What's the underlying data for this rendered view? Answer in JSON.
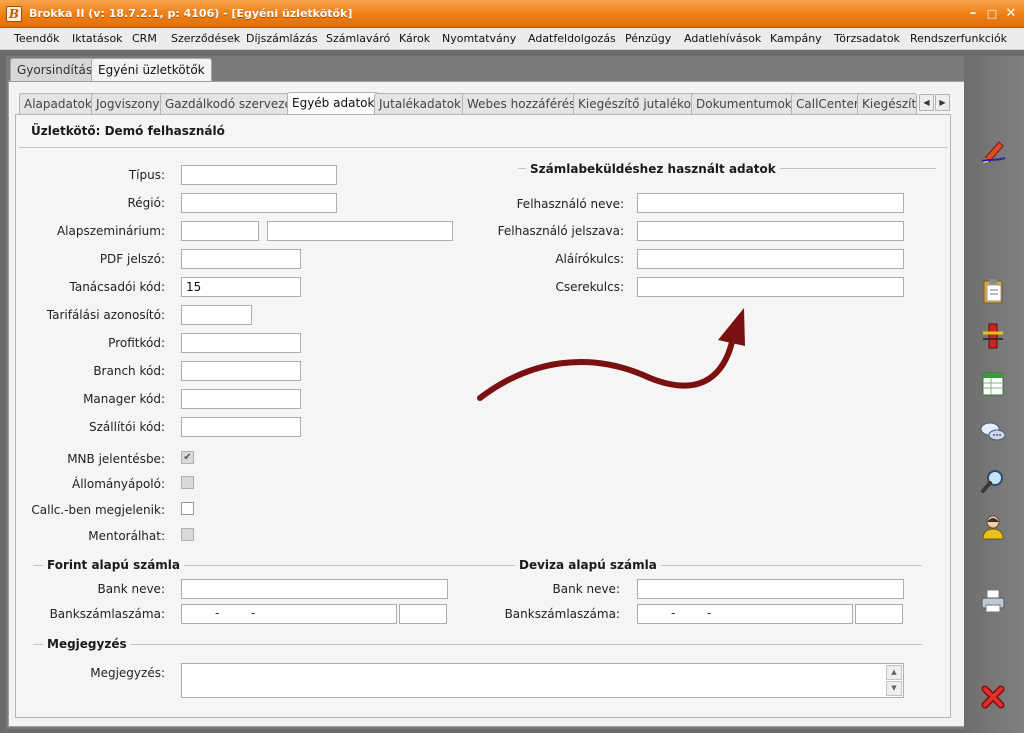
{
  "window": {
    "title": "Brokka II (v: 18.7.2.1, p: 4106) - [Egyéni üzletkötők]",
    "app_icon_letter": "B"
  },
  "menu": [
    "Teendők",
    "Iktatások",
    "CRM",
    "Szerződések",
    "Díjszámlázás",
    "Számlaváró",
    "Károk",
    "Nyomtatvány",
    "Adatfeldolgozás",
    "Pénzügy",
    "Adatlehívások",
    "Kampány",
    "Törzsadatok",
    "Rendszerfunkciók"
  ],
  "top_tabs": [
    "Gyorsindítás",
    "Egyéni üzletkötők"
  ],
  "sub_tabs": [
    "Alapadatok",
    "Jogviszony",
    "Gazdálkodó szervezet",
    "Egyéb adatok",
    "Jutalékadatok",
    "Webes hozzáférés",
    "Kiegészítő jutalékok",
    "Dokumentumok",
    "CallCenter",
    "Kiegészítő"
  ],
  "header": {
    "agent": "Üzletkötő: Demó felhasználó"
  },
  "left_fields": {
    "tipus": {
      "label": "Típus:",
      "value": ""
    },
    "regio": {
      "label": "Régió:",
      "value": ""
    },
    "alapszeminarium": {
      "label": "Alapszeminárium:",
      "value1": "",
      "value2": ""
    },
    "pdf_jelszo": {
      "label": "PDF jelszó:",
      "value": ""
    },
    "tanacsadoi_kod": {
      "label": "Tanácsadói kód:",
      "value": "15"
    },
    "tarifalasi": {
      "label": "Tarifálási azonosító:",
      "value": ""
    },
    "profitkod": {
      "label": "Profitkód:",
      "value": ""
    },
    "branch": {
      "label": "Branch kód:",
      "value": ""
    },
    "manager": {
      "label": "Manager kód:",
      "value": ""
    },
    "szallitoi": {
      "label": "Szállítói kód:",
      "value": ""
    }
  },
  "checkboxes": {
    "mnb": {
      "label": "MNB jelentésbe:",
      "checked": true,
      "disabled": true
    },
    "allomany": {
      "label": "Állományápoló:",
      "checked": false,
      "disabled": true
    },
    "callc": {
      "label": "Callc.-ben megjelenik:",
      "checked": false,
      "disabled": false
    },
    "mentor": {
      "label": "Mentorálhat:",
      "checked": false,
      "disabled": true
    }
  },
  "invoice_section": {
    "title": "Számlabeküldéshez használt adatok",
    "felhasznalo_neve": "Felhasználó neve:",
    "felhasznalo_jelszava": "Felhasználó jelszava:",
    "alairokulcs": "Aláírókulcs:",
    "cserekulcs": "Cserekulcs:"
  },
  "forint": {
    "title": "Forint alapú számla",
    "bank_label": "Bank neve:",
    "account_label": "Bankszámlaszáma:",
    "dash1": "-",
    "dash2": "-"
  },
  "deviza": {
    "title": "Deviza alapú számla",
    "bank_label": "Bank neve:",
    "account_label": "Bankszámlaszáma:",
    "dash1": "-",
    "dash2": "-"
  },
  "notes": {
    "title": "Megjegyzés",
    "label": "Megjegyzés:",
    "value": ""
  },
  "colors": {
    "titlebar": "#ee7d14",
    "arrow": "#7a1010",
    "panel": "#f5f5f5"
  },
  "right_icons": [
    "pencil-icon",
    "clipboard-icon",
    "ruler-icon",
    "spreadsheet-icon",
    "chat-icon",
    "magnifier-icon",
    "user-icon",
    "printer-icon",
    "close-x-icon"
  ]
}
